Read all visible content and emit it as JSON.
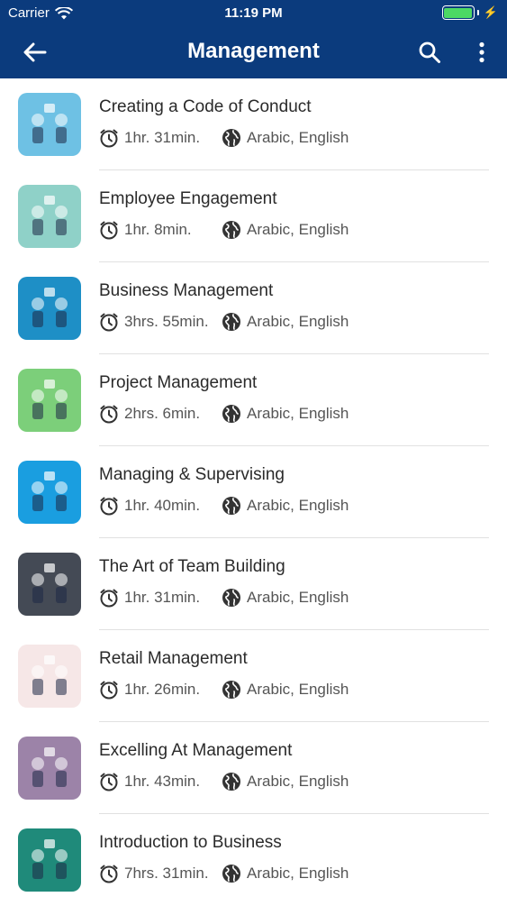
{
  "status_bar": {
    "carrier": "Carrier",
    "time": "11:19 PM",
    "battery_level": 1.0,
    "battery_color": "#4cd964"
  },
  "nav": {
    "title": "Management",
    "back_icon": "arrow-left-icon",
    "search_icon": "search-icon",
    "more_icon": "more-vertical-icon",
    "bg_color": "#0b3b7d"
  },
  "courses": [
    {
      "title": "Creating a Code of Conduct",
      "duration": "1hr. 31min.",
      "languages": "Arabic, English",
      "thumb_color": "#6ec1e4"
    },
    {
      "title": "Employee Engagement",
      "duration": "1hr. 8min.",
      "languages": "Arabic, English",
      "thumb_color": "#8fd1c8"
    },
    {
      "title": "Business Management",
      "duration": "3hrs. 55min.",
      "languages": "Arabic, English",
      "thumb_color": "#1e8fc6"
    },
    {
      "title": "Project Management",
      "duration": "2hrs. 6min.",
      "languages": "Arabic, English",
      "thumb_color": "#7ccf7a"
    },
    {
      "title": "Managing & Supervising",
      "duration": "1hr. 40min.",
      "languages": "Arabic, English",
      "thumb_color": "#1a9ee0"
    },
    {
      "title": "The Art of Team Building",
      "duration": "1hr. 31min.",
      "languages": "Arabic, English",
      "thumb_color": "#444a55"
    },
    {
      "title": "Retail Management",
      "duration": "1hr. 26min.",
      "languages": "Arabic, English",
      "thumb_color": "#f6e7e7"
    },
    {
      "title": "Excelling At Management",
      "duration": "1hr. 43min.",
      "languages": "Arabic, English",
      "thumb_color": "#9c83a8"
    },
    {
      "title": "Introduction to Business",
      "duration": "7hrs. 31min.",
      "languages": "Arabic, English",
      "thumb_color": "#1f8a7a"
    }
  ],
  "icons": {
    "duration": "clock-icon",
    "languages": "globe-icon"
  }
}
